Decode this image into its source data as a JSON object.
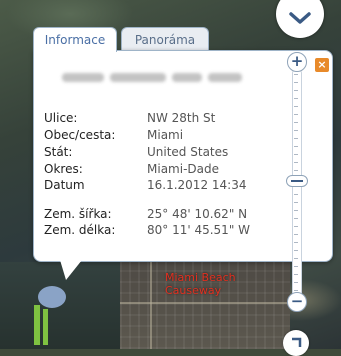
{
  "tabs": [
    {
      "label": "Informace",
      "active": true
    },
    {
      "label": "Panoráma",
      "active": false
    }
  ],
  "details": [
    {
      "label": "Ulice:",
      "value": "NW 28th St"
    },
    {
      "label": "Obec/cesta:",
      "value": "Miami"
    },
    {
      "label": "Stát:",
      "value": "United States"
    },
    {
      "label": "Okres:",
      "value": "Miami-Dade"
    },
    {
      "label": "Datum",
      "value": "16.1.2012 14:34"
    },
    {
      "label": "Zem. šířka:",
      "value": "25° 48' 10.62\" N"
    },
    {
      "label": "Zem. délka:",
      "value": "80° 11' 45.51\" W"
    }
  ],
  "map_label": {
    "line1": "Miami Beach",
    "line2": "Causeway"
  },
  "controls": {
    "zoom_in": "+",
    "zoom_out": "−",
    "close": "×",
    "zoom_level_fraction": 0.5
  },
  "icons": {
    "pan": "chevron-down-icon",
    "pegman": "pegman-icon",
    "rotate": "rotate-icon"
  },
  "colors": {
    "tab_text": "#4a6fa5",
    "border": "#9fb4c8",
    "map_label": "#e03020",
    "close": "#e88a2a"
  }
}
